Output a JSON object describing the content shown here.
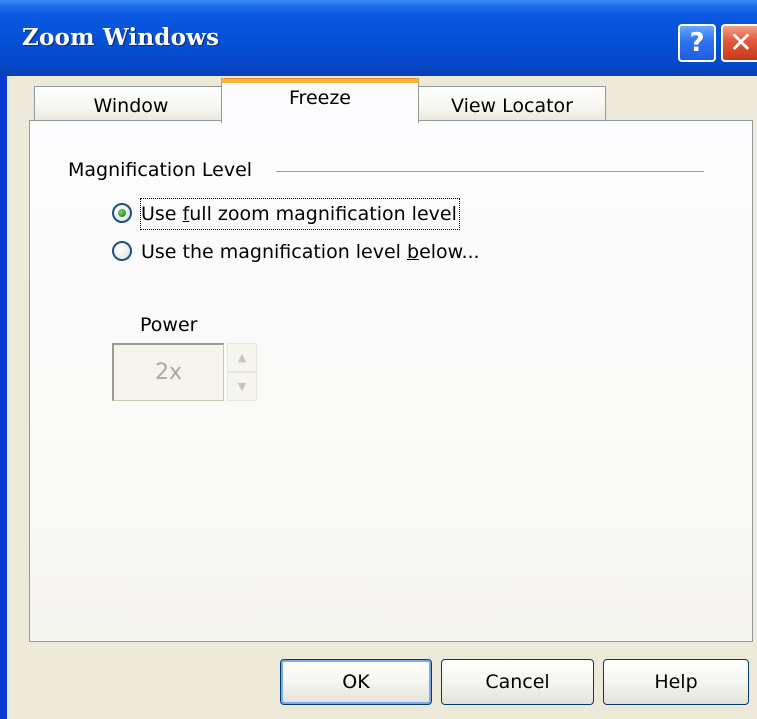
{
  "window": {
    "title": "Zoom Windows",
    "help_button_glyph": "?",
    "close_button_glyph": "✕"
  },
  "tabs": [
    {
      "label": "Window",
      "selected": false
    },
    {
      "label": "Freeze",
      "selected": true
    },
    {
      "label": "View Locator",
      "selected": false
    }
  ],
  "group": {
    "label": "Magnification Level"
  },
  "options": [
    {
      "pre": "Use ",
      "accel": "f",
      "post": "ull zoom magnification level",
      "checked": true,
      "focused": true
    },
    {
      "pre": "Use the magnification level ",
      "accel": "b",
      "post": "elow...",
      "checked": false,
      "focused": false
    }
  ],
  "power": {
    "label": "Power",
    "value": "2x",
    "enabled": false
  },
  "buttons": {
    "ok": "OK",
    "cancel": "Cancel",
    "help": "Help"
  },
  "colors": {
    "titlebar": "#0551d6",
    "client": "#ece9d8",
    "selected_tab_accent": "#f9b43a",
    "radio_checked": "#2a9a2a",
    "close_button": "#e0583a"
  },
  "icons": {
    "help": "question-mark-icon",
    "close": "close-x-icon",
    "spin_up": "up-arrow-icon",
    "spin_down": "down-arrow-icon"
  }
}
